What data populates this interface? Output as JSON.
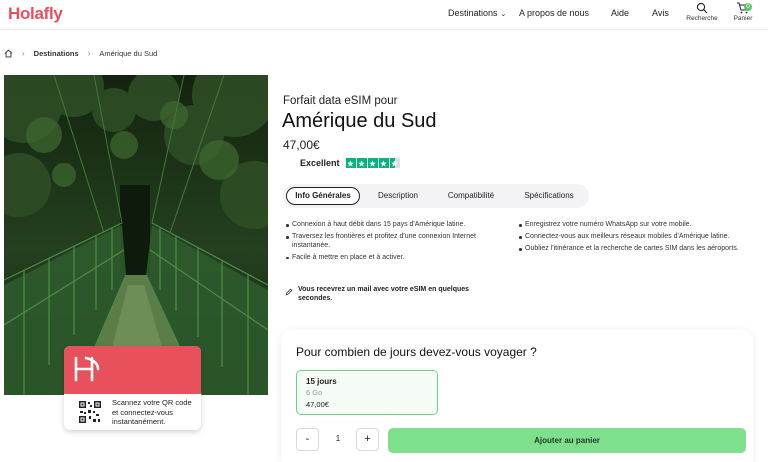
{
  "brand": {
    "logo": "Holafly",
    "accent": "#e8505b",
    "green": "#7ee08c"
  },
  "nav": {
    "destinations": "Destinations",
    "apropos": "A propos de nous",
    "aide": "Aide",
    "avis": "Avis",
    "search_label": "Recherche",
    "cart_label": "Panier",
    "cart_count": "0"
  },
  "breadcrumb": {
    "home_icon": "home-icon",
    "destinations": "Destinations",
    "current": "Amérique du Sud"
  },
  "product": {
    "subtitle": "Forfait data eSIM pour",
    "title": "Amérique du Sud",
    "price": "47,00€",
    "rating_label": "Excellent",
    "rating_stars": 4.5
  },
  "tabs": [
    "Info Générales",
    "Description",
    "Compatibilité",
    "Spécifications"
  ],
  "features_left": [
    "Connexion à haut débit dans 15 pays d'Amérique latine.",
    "Traversez les frontières et profitez d'une connexion Internet instantanée.",
    "Facile à mettre en place et à activer."
  ],
  "features_right": [
    "Enregistrez votre numéro WhatsApp sur votre mobile.",
    "Connectez-vous aux meilleurs réseaux mobiles d'Amérique latine.",
    "Oubliez l'itinérance et la recherche de cartes SIM dans les aéroports."
  ],
  "mail_note": "Vous recevrez un mail avec votre eSIM en quelques secondes.",
  "qr_card": {
    "text": "Scannez votre QR code et connectez-vous instantanément."
  },
  "booking": {
    "question": "Pour combien de jours devez-vous voyager ?",
    "plan_days": "15 jours",
    "plan_data": "6 Go",
    "plan_price": "47,00€",
    "qty_minus": "-",
    "qty_value": "1",
    "qty_plus": "+",
    "add_to_cart": "Ajouter au panier"
  }
}
